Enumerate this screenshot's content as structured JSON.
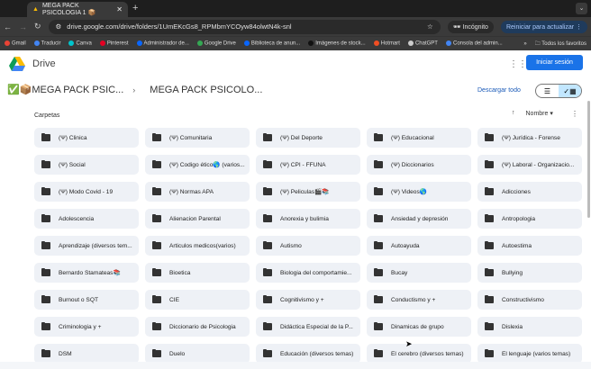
{
  "browser": {
    "tab_title": "MEGA PACK PSICOLOGIA 1 📦",
    "url": "drive.google.com/drive/folders/1UmEKcGs8_RPMbmYCOyw84olwtN4k-snl",
    "incognito_label": "Incógnito",
    "restart_label": "Reiniciar para actualizar",
    "bookmarks": [
      {
        "label": "Gmail",
        "color": "#ea4335"
      },
      {
        "label": "Traducir",
        "color": "#4285f4"
      },
      {
        "label": "Canva",
        "color": "#00c4cc"
      },
      {
        "label": "Pinterest",
        "color": "#e60023"
      },
      {
        "label": "Administrador de...",
        "color": "#0866ff"
      },
      {
        "label": "Google Drive",
        "color": "#34a853"
      },
      {
        "label": "Biblioteca de anun...",
        "color": "#0866ff"
      },
      {
        "label": "Imágenes de stock...",
        "color": "#111111"
      },
      {
        "label": "Hotmart",
        "color": "#f04e23"
      },
      {
        "label": "ChatGPT",
        "color": "#cccccc"
      },
      {
        "label": "Consola del admin...",
        "color": "#4285f4"
      }
    ],
    "more_bookmarks": "»",
    "all_favorites": "Todos los favoritos"
  },
  "drive": {
    "app_name": "Drive",
    "signin_label": "Iniciar sesión",
    "breadcrumb": [
      "✅📦MEGA PACK PSIC...",
      "MEGA PACK PSICOLO..."
    ],
    "download_all": "Descargar todo",
    "section_title": "Carpetas",
    "sort_label": "Nombre",
    "accent": "#1a73e8",
    "folders": [
      "(Ψ) Clinica",
      "(Ψ) Comunitaria",
      "(Ψ) Del Deporte",
      "(Ψ) Educacional",
      "(Ψ) Jurídica - Forense",
      "(Ψ) Social",
      "(Ψ) Codigo ético🌎 (varios...",
      "(Ψ) CPI - FFUNA",
      "(Ψ) Diccionarios",
      "(Ψ) Laboral - Organizacio...",
      "(Ψ) Modo Covid - 19",
      "(Ψ) Normas APA",
      "(Ψ) Peliculas🎬📚",
      "(Ψ) Videos🌎",
      "Adicciones",
      "Adolescencia",
      "Alienacion Parental",
      "Anorexia y bulimia",
      "Ansiedad y depresión",
      "Antropologia",
      "Aprendizaje (diversos tem...",
      "Articulos medicos(varios)",
      "Autismo",
      "Autoayuda",
      "Autoestima",
      "Bernardo Stamateas📚",
      "Bioetica",
      "Biologia del comportamie...",
      "Bucay",
      "Bullying",
      "Burnout o SQT",
      "CIE",
      "Cognitivismo y +",
      "Conductismo y +",
      "Constructivismo",
      "Criminologia y +",
      "Diccionario de Psicologia",
      "Didáctica Especial de la P...",
      "Dinamicas de grupo",
      "Dislexia",
      "DSM",
      "Duelo",
      "Educación (diversos temas)",
      "El cerebro (diversos temas)",
      "El lenguaje (varios temas)"
    ]
  }
}
